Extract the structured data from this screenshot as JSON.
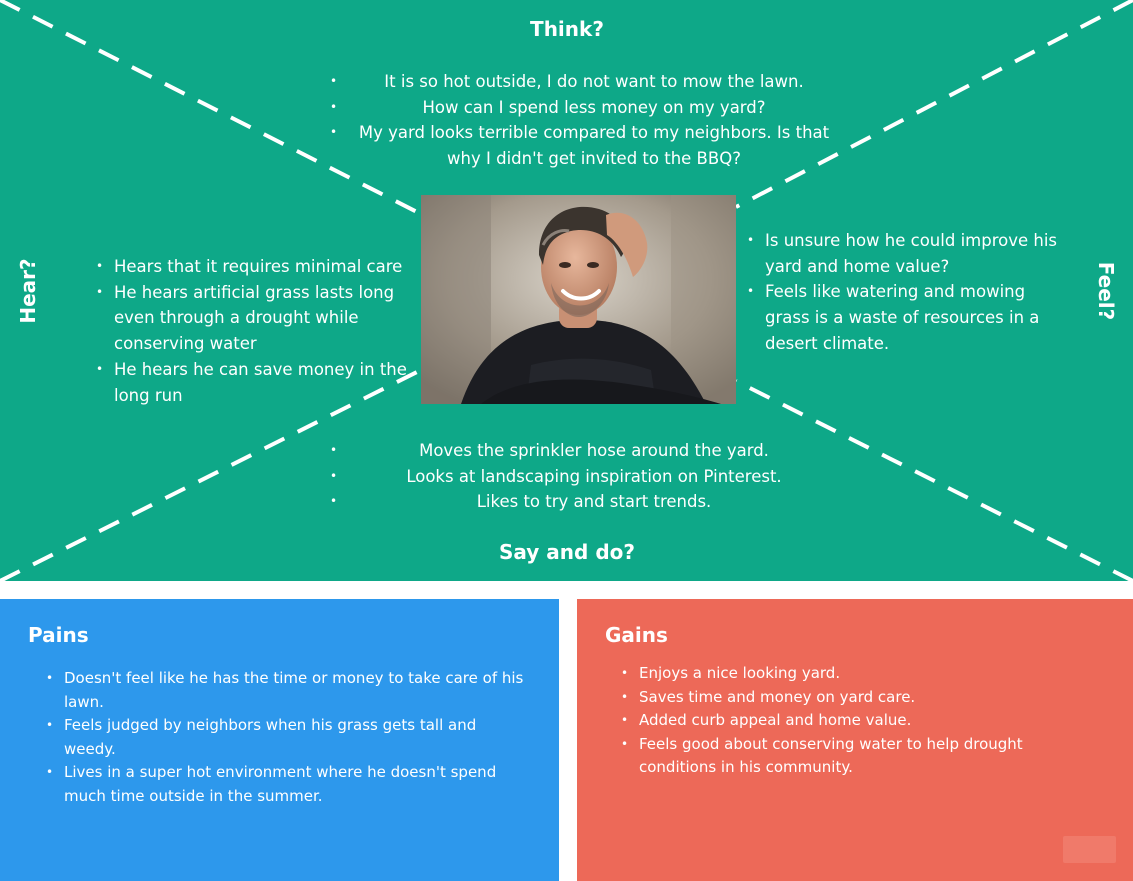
{
  "empathy_map": {
    "think": {
      "title": "Think?",
      "items": [
        "It is so hot outside, I do not want to mow the lawn.",
        "How can I spend less money on my yard?",
        "My yard looks terrible compared to my neighbors. Is that why I didn't get invited to the BBQ?"
      ]
    },
    "hear": {
      "title": "Hear?",
      "items": [
        "Hears that it requires minimal care",
        "He hears artificial grass lasts long even through a drought while conserving water",
        "He hears he can save money in the long run"
      ]
    },
    "feel": {
      "title": "Feel?",
      "items": [
        "Is unsure how he could improve his yard and home value?",
        "Feels like watering and mowing grass is a waste of resources in a desert climate."
      ]
    },
    "say_and_do": {
      "title": "Say and do?",
      "items": [
        "Moves the sprinkler hose around the yard.",
        "Looks at landscaping inspiration on Pinterest.",
        "Likes to try and start trends."
      ]
    }
  },
  "pains": {
    "title": "Pains",
    "items": [
      "Doesn't feel like he has the time or money to take care of his lawn.",
      "Feels judged by neighbors when his grass gets tall and weedy.",
      "Lives in a super hot environment where he doesn't spend much time outside in the summer."
    ]
  },
  "gains": {
    "title": "Gains",
    "items": [
      "Enjoys a nice looking yard.",
      "Saves time and money on yard care.",
      "Added curb appeal and home value.",
      "Feels good about conserving water to help drought conditions in his community."
    ]
  },
  "colors": {
    "map_green": "#0ea888",
    "pains_blue": "#2d98ec",
    "gains_coral": "#ed6958",
    "text": "#ffffff"
  }
}
